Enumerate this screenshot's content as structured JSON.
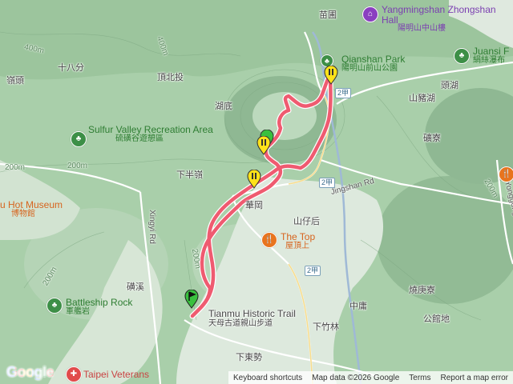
{
  "colors": {
    "route": "#ef5b70",
    "marker_yellow": "#ffe21a",
    "marker_green": "#39c03e",
    "park_green": "#2e7d32",
    "food_orange": "#e8741e",
    "hall_purple": "#8a3fc0"
  },
  "place_labels": [
    {
      "id": "miaopu",
      "text": "苗圃"
    },
    {
      "id": "shibafen",
      "text": "十八分"
    },
    {
      "id": "dingbeitou",
      "text": "頂北投"
    },
    {
      "id": "lingtou",
      "text": "嶺頭"
    },
    {
      "id": "hudi",
      "text": "湖底"
    },
    {
      "id": "xiabanling",
      "text": "下半嶺"
    },
    {
      "id": "huagang",
      "text": "華岡"
    },
    {
      "id": "shanzaihou",
      "text": "山仔后"
    },
    {
      "id": "toutouhu",
      "text": "頭湖"
    },
    {
      "id": "shanzhuhu",
      "text": "山豬湖"
    },
    {
      "id": "kuangliao",
      "text": "礦寮"
    },
    {
      "id": "lixi",
      "text": "磺溪"
    },
    {
      "id": "shaokangliao",
      "text": "燒庚寮"
    },
    {
      "id": "zhongpu",
      "text": "中庸"
    },
    {
      "id": "gongguandi",
      "text": "公館地"
    },
    {
      "id": "xiazhulin",
      "text": "下竹林"
    },
    {
      "id": "xiadongshi",
      "text": "下東勢"
    }
  ],
  "road_labels": {
    "xingyi": "Xingyi Rd",
    "jingshan": "Jingshan Rd",
    "yonggong": "Yonggong Rd"
  },
  "road_shields": [
    "2甲",
    "2甲",
    "2甲"
  ],
  "pois": {
    "sulfur_valley": {
      "en": "Sulfur Valley Recreation Area",
      "zh": "硫磺谷遊憩區",
      "icon": "park-icon"
    },
    "hot_museum": {
      "en": "u Hot Museum",
      "zh": "博物館",
      "icon": "museum-icon"
    },
    "battleship_rock": {
      "en": "Battleship Rock",
      "zh": "軍艦岩",
      "icon": "park-icon"
    },
    "qianshan_park": {
      "en": "Qianshan Park",
      "zh": "陽明山前山公園",
      "icon": "park-icon"
    },
    "zhongshan_hall": {
      "en": "Yangmingshan Zhongshan Hall",
      "zh": "陽明山中山樓",
      "icon": "landmark-icon"
    },
    "juansi": {
      "en": "Juansi F",
      "zh": "絹絲瀑布",
      "icon": "park-icon"
    },
    "the_top": {
      "en": "The Top",
      "zh": "屋頂上",
      "icon": "restaurant-icon"
    },
    "tianmu_trail": {
      "en": "Tianmu Historic Trail",
      "zh": "天母古道親山步道"
    },
    "veterans": {
      "en": "Taipei Veterans",
      "zh": ""
    }
  },
  "elevation_labels": [
    "400m",
    "200m",
    "200m",
    "400m",
    "200m",
    "200m",
    "200m"
  ],
  "footer": {
    "logo": "Google",
    "shortcuts": "Keyboard shortcuts",
    "map_data": "Map data ©2026 Google",
    "terms": "Terms",
    "report": "Report a map error"
  }
}
